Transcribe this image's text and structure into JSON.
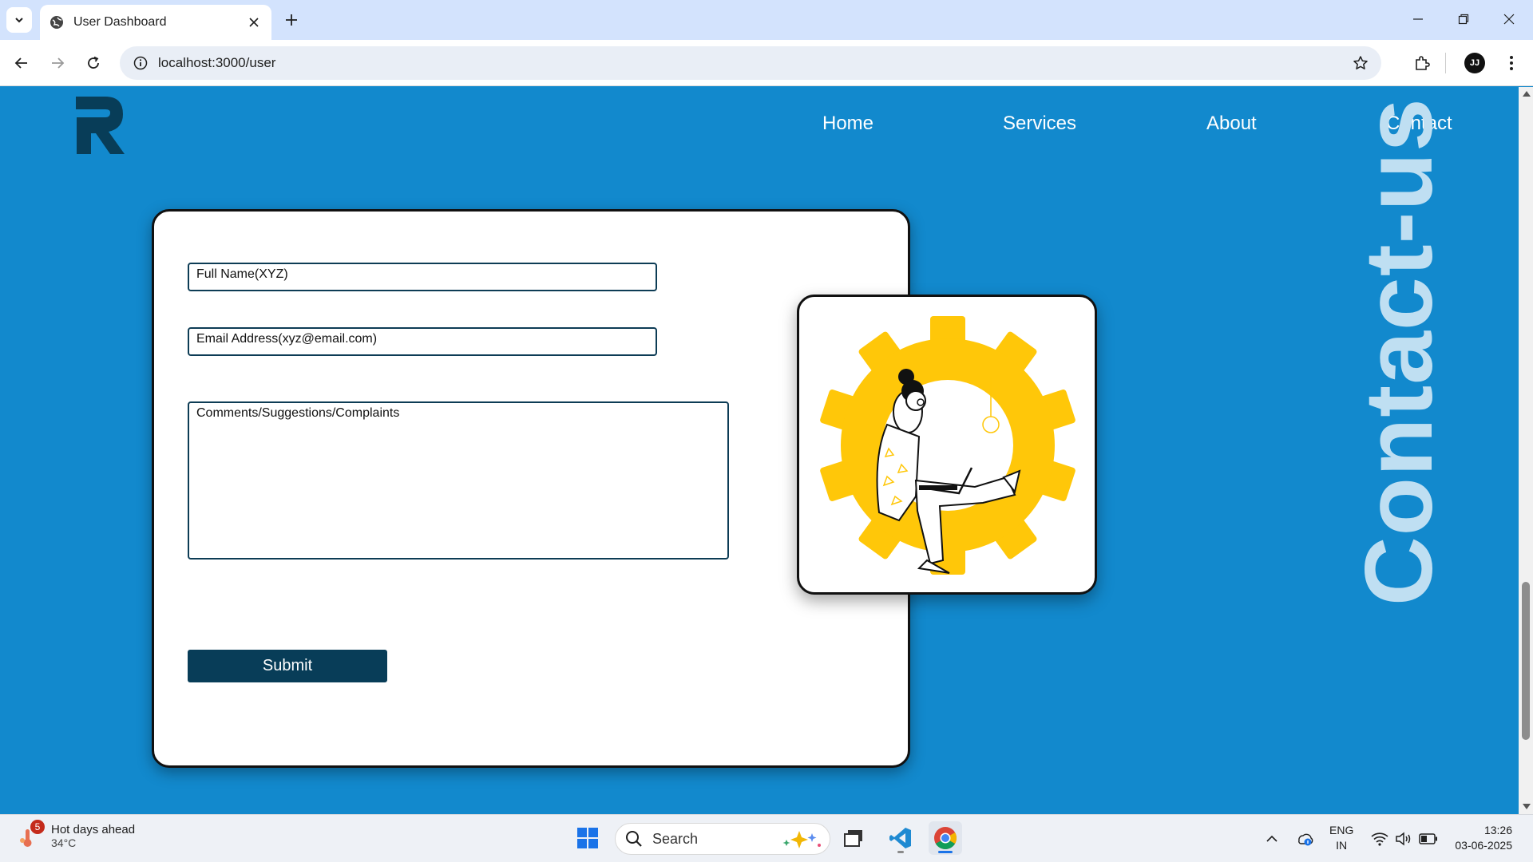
{
  "browser": {
    "tab_title": "User Dashboard",
    "url": "localhost:3000/user",
    "profile_initials": "JJ"
  },
  "site": {
    "logo_letter": "R",
    "nav": [
      "Home",
      "Services",
      "About",
      "Contact"
    ],
    "vertical_heading": "Contact-us"
  },
  "form": {
    "full_name_placeholder": "Full Name(XYZ)",
    "email_placeholder": "Email Address(xyz@email.com)",
    "comments_placeholder": "Comments/Suggestions/Complaints",
    "submit_label": "Submit"
  },
  "taskbar": {
    "weather_title": "Hot days ahead",
    "weather_temp": "34°C",
    "weather_badge": "5",
    "search_label": "Search",
    "lang_line1": "ENG",
    "lang_line2": "IN",
    "time": "13:26",
    "date": "03-06-2025"
  },
  "colors": {
    "page_background": "#1289cd",
    "submit_background": "#083d58",
    "gear_yellow": "#ffc709",
    "heading_text": "#bfdff2"
  },
  "icons": [
    "tab-list-icon",
    "globe-icon",
    "close-icon",
    "plus-icon",
    "minimize-icon",
    "restore-icon",
    "back-icon",
    "forward-icon",
    "reload-icon",
    "info-icon",
    "star-icon",
    "extensions-icon",
    "menu-icon",
    "windows-start-icon",
    "search-icon",
    "copilot-icon",
    "file-explorer-icon",
    "vscode-icon",
    "chrome-icon",
    "chevron-up-icon",
    "network-icon",
    "wifi-icon",
    "volume-icon",
    "battery-icon"
  ]
}
